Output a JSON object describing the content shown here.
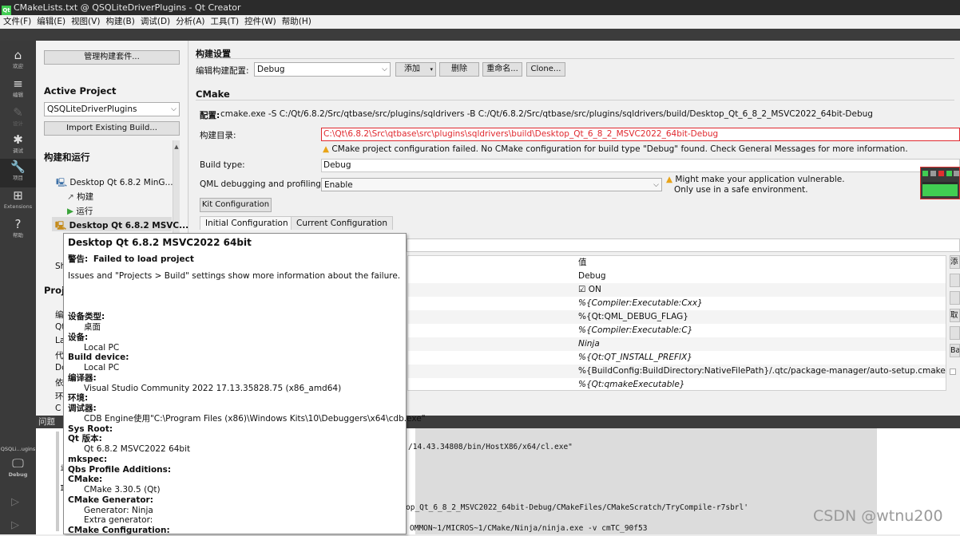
{
  "window": {
    "title": "CMakeLists.txt @ QSQLiteDriverPlugins - Qt Creator",
    "qt_badge": "Qt"
  },
  "menu": [
    "文件(F)",
    "编辑(E)",
    "视图(V)",
    "构建(B)",
    "调试(D)",
    "分析(A)",
    "工具(T)",
    "控件(W)",
    "帮助(H)"
  ],
  "modes": [
    {
      "label": "欢迎",
      "icon": "home-icon"
    },
    {
      "label": "编辑",
      "icon": "edit-icon"
    },
    {
      "label": "设计",
      "icon": "design-icon"
    },
    {
      "label": "调试",
      "icon": "bug-icon"
    },
    {
      "label": "项目",
      "icon": "wrench-icon"
    },
    {
      "label": "Extensions",
      "icon": "extensions-icon"
    },
    {
      "label": "帮助",
      "icon": "help-icon"
    }
  ],
  "mode_glyphs": {
    "home": "⌂",
    "edit": "≡",
    "design": "✎",
    "debug": "✱",
    "projects": "🔧",
    "extensions": "⊞",
    "help": "?",
    "target": "🖵",
    "run": "▷",
    "debug_run": "▷"
  },
  "target": {
    "project": "QSQLi...ugins",
    "config": "Debug"
  },
  "sidebar": {
    "manage_kits": "管理构建套件...",
    "active_project_title": "Active Project",
    "active_project": "QSQLiteDriverPlugins",
    "import_build": "Import Existing Build...",
    "build_run_title": "构建和运行",
    "kit_mingw": "Desktop Qt 6.8.2 MinG...",
    "build": "构建",
    "run": "运行",
    "kit_msvc": "Desktop Qt 6.8.2 MSVC...",
    "partial": [
      "Sh",
      "Proj",
      "编",
      "Qt",
      "La",
      "代",
      "Do",
      "依",
      "环",
      "C"
    ]
  },
  "build_settings": {
    "title": "构建设置",
    "edit_config_label": "编辑构建配置:",
    "config": "Debug",
    "add": "添加",
    "delete": "删除",
    "rename": "重命名...",
    "clone": "Clone...",
    "cmake_title": "CMake",
    "config_label": "配置:",
    "config_cmd": "cmake.exe -S C:/Qt/6.8.2/Src/qtbase/src/plugins/sqldrivers -B C:/Qt/6.8.2/Src/qtbase/src/plugins/sqldrivers/build/Desktop_Qt_6_8_2_MSVC2022_64bit-Debug",
    "build_dir_label": "构建目录:",
    "build_dir": "C:\\Qt\\6.8.2\\Src\\qtbase\\src\\plugins\\sqldrivers\\build\\Desktop_Qt_6_8_2_MSVC2022_64bit-Debug",
    "warning": "CMake project configuration failed. No CMake configuration for build type \"Debug\" found. Check General Messages for more information.",
    "build_type_label": "Build type:",
    "build_type": "Debug",
    "qml_label": "QML debugging and profiling:",
    "qml_value": "Enable",
    "qml_warn1": "Might make your application vulnerable.",
    "qml_warn2": "Only use in a safe environment.",
    "kit_config": "Kit Configuration",
    "tab_initial": "Initial Configuration",
    "tab_current": "Current Configuration",
    "value_header": "值",
    "values": [
      "Debug",
      "☑ ON",
      "%{Compiler:Executable:Cxx}",
      "%{Qt:QML_DEBUG_FLAG}",
      "%{Compiler:Executable:C}",
      "Ninja",
      "%{Qt:QT_INSTALL_PREFIX}",
      "%{BuildConfig:BuildDirectory:NativeFilePath}/.qtc/package-manager/auto-setup.cmake",
      "%{Qt:qmakeExecutable}"
    ],
    "right_buttons": [
      "添",
      "",
      "",
      "取",
      "",
      "Ba"
    ]
  },
  "colors": {
    "error": "#e0282e",
    "warn": "#e8a317",
    "accent": "#41cd52"
  },
  "popup": {
    "title": "Desktop Qt 6.8.2 MSVC2022 64bit",
    "warn_label": "警告:",
    "warn_text": "Failed to load project",
    "info": "Issues and \"Projects > Build\" settings show more information about the failure.",
    "rows": [
      {
        "k": "设备类型:",
        "v": "桌面"
      },
      {
        "k": "设备:",
        "v": "Local PC"
      },
      {
        "k": "Build device:",
        "v": "Local PC"
      },
      {
        "k": "编译器:",
        "v": "Visual Studio Community 2022 17.13.35828.75 (x86_amd64)"
      },
      {
        "k": "环境:",
        "v": ""
      },
      {
        "k": "调试器:",
        "v": "CDB Engine使用\"C:\\Program Files (x86)\\Windows Kits\\10\\Debuggers\\x64\\cdb.exe\""
      },
      {
        "k": "Sys Root:",
        "v": ""
      },
      {
        "k": "Qt 版本:",
        "v": "Qt 6.8.2 MSVC2022 64bit"
      },
      {
        "k": "mkspec:",
        "v": ""
      },
      {
        "k": "Qbs Profile Additions:",
        "v": ""
      },
      {
        "k": "CMake:",
        "v": "CMake 3.30.5 (Qt)"
      },
      {
        "k": "CMake Generator:",
        "v": "Generator: Ninja"
      },
      {
        "k": "",
        "v": "Extra generator:"
      },
      {
        "k": "CMake Configuration:",
        "v": ""
      }
    ]
  },
  "bottom": {
    "issues": "问题"
  },
  "output": [
    "/14.43.34808/bin/HostX86/x64/cl.exe\"",
    "op_Qt_6_8_2_MSVC2022_64bit-Debug/CMakeFiles/CMakeScratch/TryCompile-r7sbrl'",
    "OMMON~1/MICROS~1/CMake/Ninja/ninja.exe -v cmTC_90f53"
  ],
  "output_left": [
    "i",
    "I"
  ],
  "watermark": "CSDN @wtnu200"
}
